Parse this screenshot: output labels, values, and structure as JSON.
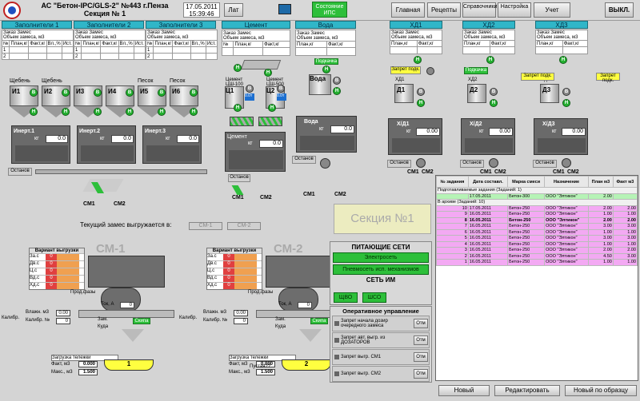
{
  "header": {
    "title": "АС \"Бетон-IPC/GLS-2\" №443 г.Пенза",
    "subtitle": "Секция № 1",
    "date": "17.05.2011",
    "time": "15:39:46",
    "lat_label": "Лат",
    "ips_status_label": "Состояние ИПС",
    "nav": [
      "Главная",
      "Рецепты",
      "Справочники",
      "Настройка",
      "Учет"
    ],
    "exit_label": "ВЫКЛ."
  },
  "fillers": {
    "panels": [
      "Заполнители 1",
      "Заполнители 2",
      "Заполнители 3"
    ],
    "col_zakaz": "Заказ",
    "col_zames": "Замес",
    "col_obem": "Объем замеса, м3",
    "cols": [
      "№",
      "План,кг",
      "Факт,кг",
      "Вл.,%",
      "Ист."
    ],
    "rows": [
      "1",
      "2"
    ],
    "silo_labels": [
      "Щебень",
      "Щебень",
      "",
      "",
      "Песок",
      "Песок"
    ],
    "silo_ids": [
      "И1",
      "И2",
      "И3",
      "И4",
      "И5",
      "И6"
    ],
    "inert_labels": [
      "Инерт.1",
      "Инерт.2",
      "Инерт.3"
    ],
    "kg": "кг",
    "stop": "Останов",
    "zero": "0.0"
  },
  "cement": {
    "panel": "Цемент",
    "cols": [
      "№",
      "План,кг",
      "Факт,кг"
    ],
    "silo_labels": [
      "Цемент ЦШ-100",
      "Цемент ЦШ-500"
    ],
    "silo_ids": [
      "Ц1",
      "Ц2"
    ],
    "values": [
      "0.0т",
      "0.0т"
    ],
    "scale_label": "Цемент",
    "kg": "кг",
    "zero": "0.0",
    "stop": "Останов",
    "mixers": [
      "СМ1",
      "СМ2"
    ]
  },
  "water": {
    "panel": "Вода",
    "cols": [
      "План,кг",
      "Факт,кг"
    ],
    "feed": "Подкачка",
    "tank": "Вода",
    "scale_label": "Вода",
    "kg": "кг",
    "zero": "0.0",
    "stop": "Останов",
    "mixers": [
      "СМ1",
      "СМ2"
    ]
  },
  "additives": {
    "panels": [
      "ХД1",
      "ХД2",
      "ХД3"
    ],
    "cols": [
      "План,кг",
      "Факт,кг"
    ],
    "ban_feed": "Запрет подк.",
    "feed": "Подкачка",
    "ban_feed2": "Запрет подк.",
    "tanks": [
      "ХД1",
      "ХД2",
      "ХД3"
    ],
    "ids": [
      "Д1",
      "Д2",
      "Д3"
    ],
    "scale_labels": [
      "Х/Д1",
      "Х/Д2",
      "Х/Д3"
    ],
    "kg": "кг",
    "zero": "0.00",
    "stop": "Останов",
    "mixers": [
      "СМ1",
      "СМ2"
    ]
  },
  "fillers_mixers": [
    "СМ1",
    "СМ2"
  ],
  "unload_text": "Текущий замес выгружается в:",
  "unload_targets": [
    "СМ-1",
    "СМ-2"
  ],
  "section_label": "Секция №1",
  "mixers": {
    "titles": [
      "СМ-1",
      "СМ-2"
    ],
    "variant_label": "Вариант выгрузки",
    "cols": [
      "№",
      "Т",
      "Т"
    ],
    "rows": [
      "За.с",
      "Дв.с",
      "Ц.с",
      "Вд.с",
      "Хд.с"
    ],
    "row_values": [
      "0",
      "0",
      "0",
      "0",
      "0"
    ],
    "prod_label": "Прод.фазы",
    "tok_label": "Ток, А",
    "tok_value": "0",
    "zam_label": "Зам.",
    "kud_label": "Куда",
    "calib_label": "Калибр.",
    "moist_label": "Влажн. м3",
    "calib_num_label": "Калибр. №",
    "moist_value": "0.00",
    "calib_num_value": "0",
    "skip_label": "Скипа",
    "truck_label": "Загрузка тележки",
    "truck_ids": [
      "1",
      "2"
    ],
    "fact_label": "Факт, м3",
    "max_label": "Макс., м3",
    "fact_values": [
      "0.000",
      "0.000"
    ],
    "max_values": [
      "1.500",
      "1.500"
    ],
    "empty": "Пустая??"
  },
  "networks": {
    "title": "ПИТАЮЩИЕ СЕТИ",
    "items": [
      "Электросеть",
      "Пневмосеть исп. механизмов"
    ],
    "net_title": "СЕТЬ ИМ",
    "im_items": [
      "ЩВО",
      "ШСО"
    ]
  },
  "ops": {
    "title": "Оперативное управление",
    "rows": [
      {
        "label": "Запрет начала дозир очередного замеса",
        "btn": "Отм"
      },
      {
        "label": "Запрет авт. выгр. из ДОЗАТОРОВ",
        "btn": "Отм"
      },
      {
        "label": "Запрет выгр. СМ1",
        "btn": "Отм"
      },
      {
        "label": "Запрет выгр. СМ2",
        "btn": "Отм"
      }
    ]
  },
  "orders": {
    "cols": [
      "№ задания",
      "Дата составл.",
      "Марка смеси",
      "Назначение",
      "План м3",
      "Факт м3"
    ],
    "group1": "Подготавливаемые задания    (Заданий: 1)",
    "group1_rows": [
      {
        "n": "",
        "date": "17.05.2011",
        "mark": "Бетон-300",
        "dest": "ООО \"Элтикон\"",
        "plan": "2.00",
        "fact": ""
      }
    ],
    "group2": "В архиве       (Заданий: 10)",
    "group2_rows": [
      {
        "n": "10",
        "date": "17.05.2011",
        "mark": "Бетон-250",
        "dest": "ООО \"Элтикон\"",
        "plan": "2.00",
        "fact": "2.00"
      },
      {
        "n": "9",
        "date": "16.05.2011",
        "mark": "Бетон-250",
        "dest": "ООО \"Элтикон\"",
        "plan": "1.00",
        "fact": "1.00"
      },
      {
        "n": "8",
        "date": "16.05.2011",
        "mark": "Бетон-250",
        "dest": "ООО \"Элтикон\"",
        "plan": "2.00",
        "fact": "2.00"
      },
      {
        "n": "7",
        "date": "16.05.2011",
        "mark": "Бетон-250",
        "dest": "ООО \"Элтикон\"",
        "plan": "3.00",
        "fact": "3.00"
      },
      {
        "n": "6",
        "date": "16.05.2011",
        "mark": "Бетон-250",
        "dest": "ООО \"Элтикон\"",
        "plan": "1.00",
        "fact": "1.00"
      },
      {
        "n": "5",
        "date": "16.05.2011",
        "mark": "Бетон-250",
        "dest": "ООО \"Элтикон\"",
        "plan": "3.00",
        "fact": "3.00"
      },
      {
        "n": "4",
        "date": "16.05.2011",
        "mark": "Бетон-250",
        "dest": "ООО \"Элтикон\"",
        "plan": "1.00",
        "fact": "1.00"
      },
      {
        "n": "3",
        "date": "16.05.2011",
        "mark": "Бетон-250",
        "dest": "ООО \"Элтикон\"",
        "plan": "2.00",
        "fact": "2.00"
      },
      {
        "n": "2",
        "date": "16.05.2011",
        "mark": "Бетон-250",
        "dest": "ООО \"Элтикон\"",
        "plan": "4.50",
        "fact": "3.00"
      },
      {
        "n": "1",
        "date": "16.05.2011",
        "mark": "Бетон-250",
        "dest": "ООО \"Элтикон\"",
        "plan": "1.00",
        "fact": "1.00"
      }
    ]
  },
  "footer": {
    "new": "Новый",
    "edit": "Редактировать",
    "new_sample": "Новый по образцу"
  },
  "colors": {
    "accent": "#30b6c8",
    "status_green": "#2dbf3a",
    "archive_pink": "#f3a9f3"
  }
}
